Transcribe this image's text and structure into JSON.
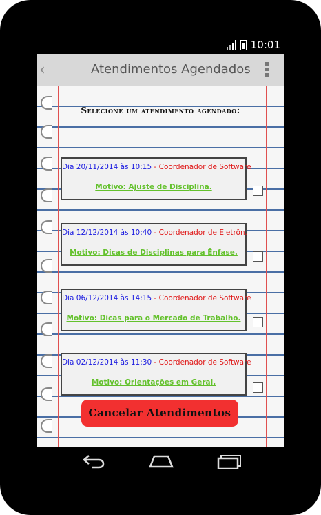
{
  "status_bar": {
    "time": "10:01"
  },
  "action_bar": {
    "title": "Atendimentos Agendados",
    "back_glyph": "‹",
    "menu_icon": "overflow-menu-icon"
  },
  "heading": "Selecione um atendimento agendado:",
  "appointments": [
    {
      "date_text": "Dia 20/11/2014 às 10:15",
      "separator": " - ",
      "coordinator": "Coordenador de Software",
      "reason": "Motivo: Ajuste de Disciplina.",
      "checked": false
    },
    {
      "date_text": "Dia 12/12/2014 às 10:40",
      "separator": " - ",
      "coordinator": "Coordenador de Eletrôn.",
      "reason": "Motivo: Dicas de Disciplinas para Ênfase.",
      "checked": false
    },
    {
      "date_text": "Dia 06/12/2014 às 14:15",
      "separator": " - ",
      "coordinator": "Coordenador de Software",
      "reason": "Motivo: Dicas para o Mercado de Trabalho.",
      "checked": false
    },
    {
      "date_text": "Dia 02/12/2014 às 11:30",
      "separator": " - ",
      "coordinator": "Coordenador de Software",
      "reason": "Motivo: Orientações em Geral.",
      "checked": false
    }
  ],
  "cancel_button": "Cancelar Atendimentos",
  "colors": {
    "date": "#1a1ae0",
    "coordinator": "#e01818",
    "reason": "#63c12c",
    "button": "#f23030",
    "ruled_line": "#4a6fa5",
    "margin": "#e05050"
  },
  "nav_icons": [
    "back-icon",
    "home-icon",
    "recent-apps-icon"
  ]
}
